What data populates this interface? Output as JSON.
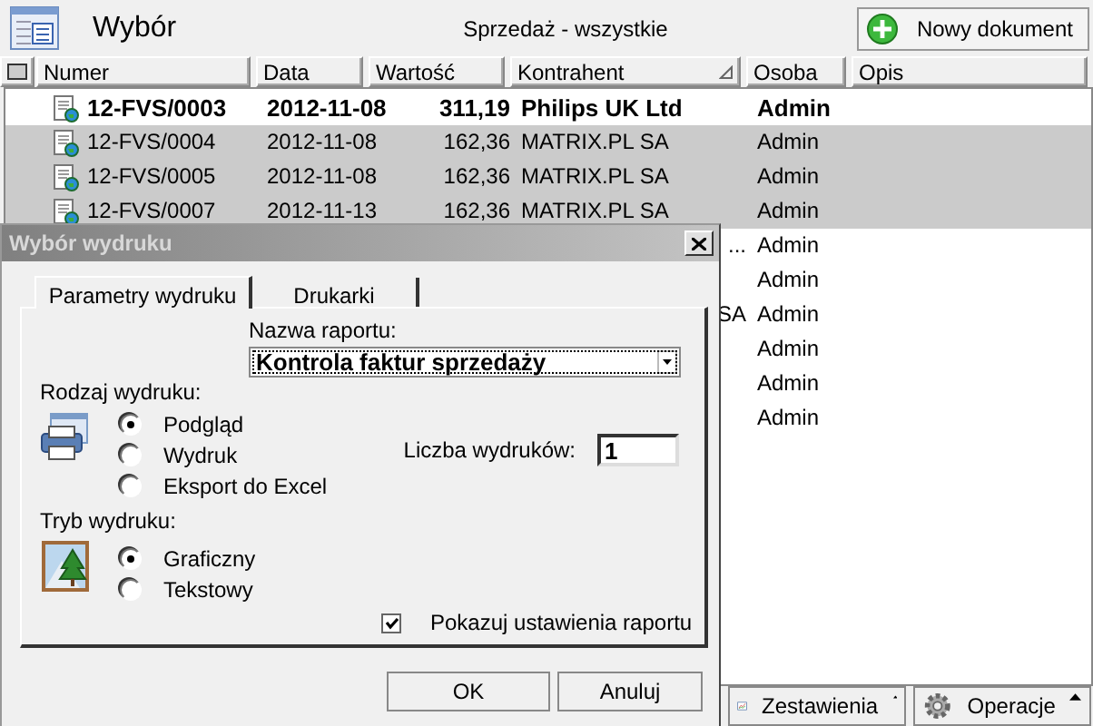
{
  "header": {
    "title": "Wybór",
    "view": "Sprzedaż - wszystkie",
    "new_button": "Nowy dokument"
  },
  "table": {
    "columns": [
      {
        "label": "Numer",
        "sorted": false
      },
      {
        "label": "Data",
        "sorted": false
      },
      {
        "label": "Wartość",
        "sorted": false
      },
      {
        "label": "Kontrahent",
        "sorted": true
      },
      {
        "label": "Osoba",
        "sorted": false
      },
      {
        "label": "Opis",
        "sorted": false
      }
    ],
    "rows": [
      {
        "numer": "12-FVS/0003",
        "data": "2012-11-08",
        "wartosc": "311,19",
        "kontrahent": "Philips UK Ltd",
        "osoba": "Admin",
        "selected": false,
        "bold": true
      },
      {
        "numer": "12-FVS/0004",
        "data": "2012-11-08",
        "wartosc": "162,36",
        "kontrahent": "MATRIX.PL SA",
        "osoba": "Admin",
        "selected": true,
        "bold": false
      },
      {
        "numer": "12-FVS/0005",
        "data": "2012-11-08",
        "wartosc": "162,36",
        "kontrahent": "MATRIX.PL SA",
        "osoba": "Admin",
        "selected": true,
        "bold": false
      },
      {
        "numer": "12-FVS/0007",
        "data": "2012-11-13",
        "wartosc": "162,36",
        "kontrahent": "MATRIX.PL SA",
        "osoba": "Admin",
        "selected": true,
        "bold": false
      },
      {
        "kontrahent": "...",
        "osoba": "Admin",
        "selected": false,
        "bold": false
      },
      {
        "osoba": "Admin",
        "selected": false,
        "bold": false
      },
      {
        "kontrahent": "SA",
        "osoba": "Admin",
        "selected": false,
        "bold": false
      },
      {
        "osoba": "Admin",
        "selected": false,
        "bold": false
      },
      {
        "osoba": "Admin",
        "selected": false,
        "bold": false
      },
      {
        "osoba": "Admin",
        "selected": false,
        "bold": false
      }
    ]
  },
  "bottom_buttons": [
    {
      "label": "Zestawienia",
      "kind": "chart"
    },
    {
      "label": "Operacje",
      "kind": "gear"
    }
  ],
  "dialog": {
    "title": "Wybór wydruku",
    "tabs": [
      {
        "label": "Parametry wydruku",
        "selected": true
      },
      {
        "label": "Drukarki",
        "selected": false
      }
    ],
    "report_label": "Nazwa raportu:",
    "report_value": "Kontrola faktur sprzedaży",
    "print_type": {
      "label": "Rodzaj wydruku:",
      "options": [
        {
          "label": "Podgląd",
          "selected": true
        },
        {
          "label": "Wydruk",
          "selected": false
        },
        {
          "label": "Eksport do Excel",
          "selected": false
        }
      ]
    },
    "copies": {
      "label": "Liczba wydruków:",
      "value": "1"
    },
    "print_mode": {
      "label": "Tryb wydruku:",
      "options": [
        {
          "label": "Graficzny",
          "selected": true
        },
        {
          "label": "Tekstowy",
          "selected": false
        }
      ]
    },
    "show_settings": {
      "label": "Pokazuj ustawienia raportu",
      "checked": true
    },
    "buttons": [
      "OK",
      "Anuluj"
    ]
  }
}
